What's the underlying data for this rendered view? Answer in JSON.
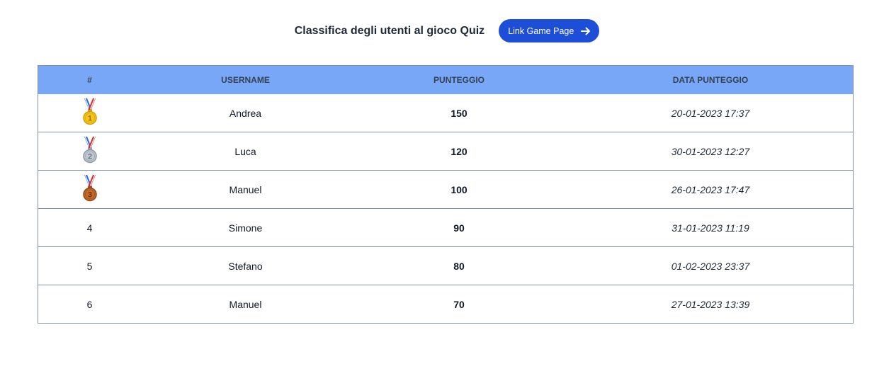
{
  "header": {
    "title": "Classifica degli utenti al gioco Quiz",
    "link_label": "Link Game Page"
  },
  "table": {
    "columns": [
      "#",
      "USERNAME",
      "PUNTEGGIO",
      "DATA PUNTEGGIO"
    ],
    "rows": [
      {
        "rank": "1",
        "medal": "gold-medal-icon",
        "username": "Andrea",
        "score": "150",
        "date": "20-01-2023 17:37"
      },
      {
        "rank": "2",
        "medal": "silver-medal-icon",
        "username": "Luca",
        "score": "120",
        "date": "30-01-2023 12:27"
      },
      {
        "rank": "3",
        "medal": "bronze-medal-icon",
        "username": "Manuel",
        "score": "100",
        "date": "26-01-2023 17:47"
      },
      {
        "rank": "4",
        "username": "Simone",
        "score": "90",
        "date": "31-01-2023 11:19"
      },
      {
        "rank": "5",
        "username": "Stefano",
        "score": "80",
        "date": "01-02-2023 23:37"
      },
      {
        "rank": "6",
        "username": "Manuel",
        "score": "70",
        "date": "27-01-2023 13:39"
      }
    ]
  },
  "colors": {
    "button": "#1d4ed8",
    "table_header": "#78a7f7",
    "gold": "#f5c518",
    "silver": "#c0c8d2",
    "bronze": "#c46a2b"
  }
}
